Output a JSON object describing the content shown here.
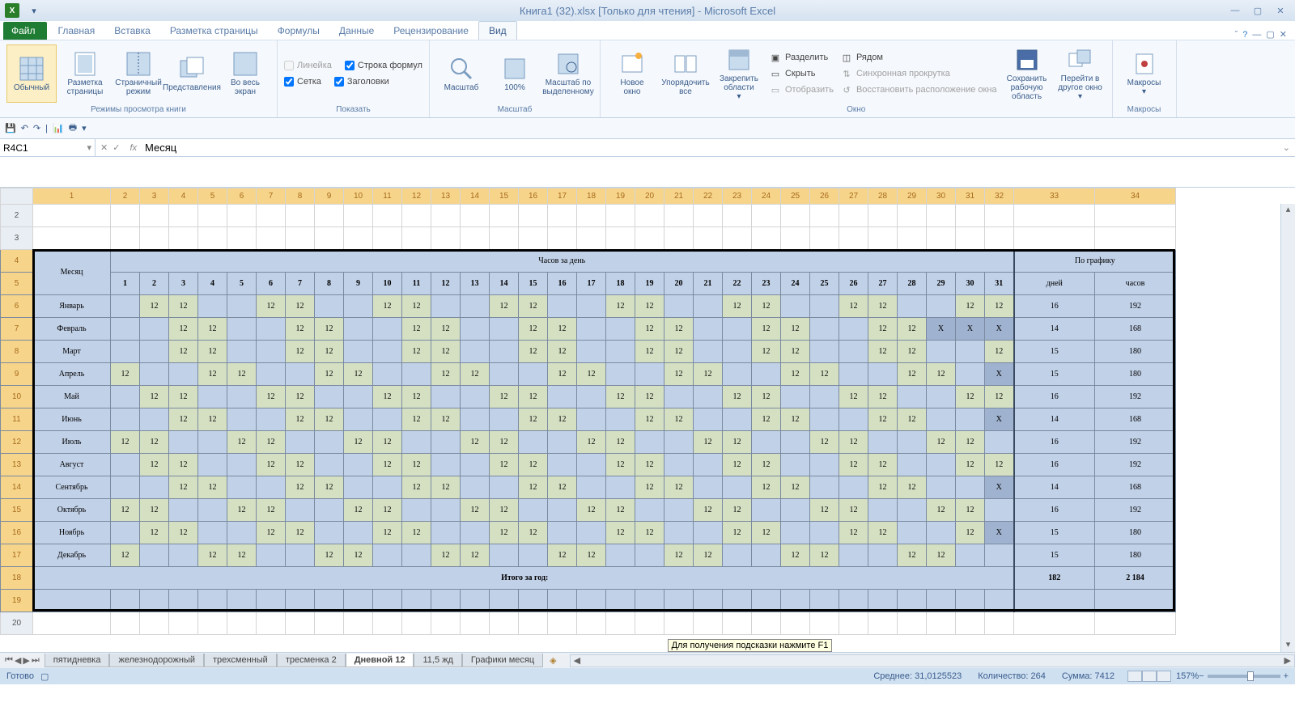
{
  "title": "Книга1 (32).xlsx  [Только для чтения]  -  Microsoft Excel",
  "tabs": {
    "file": "Файл",
    "home": "Главная",
    "insert": "Вставка",
    "layout": "Разметка страницы",
    "formulas": "Формулы",
    "data": "Данные",
    "review": "Рецензирование",
    "view": "Вид"
  },
  "ribbon": {
    "g1": {
      "label": "Режимы просмотра книги",
      "normal": "Обычный",
      "pagelayout": "Разметка\nстраницы",
      "pagebreak": "Страничный\nрежим",
      "custom": "Представления",
      "full": "Во весь\nэкран"
    },
    "g2": {
      "label": "Показать",
      "ruler": "Линейка",
      "formula": "Строка формул",
      "grid": "Сетка",
      "headings": "Заголовки"
    },
    "g3": {
      "label": "Масштаб",
      "zoom": "Масштаб",
      "z100": "100%",
      "zsel": "Масштаб по\nвыделенному"
    },
    "g4": {
      "label": "Окно",
      "newwin": "Новое\nокно",
      "arrange": "Упорядочить\nвсе",
      "freeze": "Закрепить\nобласти",
      "split": "Разделить",
      "hide": "Скрыть",
      "unhide": "Отобразить",
      "side": "Рядом",
      "sync": "Синхронная прокрутка",
      "reset": "Восстановить расположение окна",
      "save": "Сохранить\nрабочую область",
      "switch": "Перейти в\nдругое окно"
    },
    "g5": {
      "label": "Макросы",
      "macros": "Макросы"
    }
  },
  "namebox": "R4C1",
  "formula": "Месяц",
  "columns": [
    "1",
    "2",
    "3",
    "4",
    "5",
    "6",
    "7",
    "8",
    "9",
    "10",
    "11",
    "12",
    "13",
    "14",
    "15",
    "16",
    "17",
    "18",
    "19",
    "20",
    "21",
    "22",
    "23",
    "24",
    "25",
    "26",
    "27",
    "28",
    "29",
    "30",
    "31",
    "32",
    "33",
    "34"
  ],
  "rows_visible": [
    "2",
    "3",
    "4",
    "5",
    "6",
    "7",
    "8",
    "9",
    "10",
    "11",
    "12",
    "13",
    "14",
    "15",
    "16",
    "17",
    "18",
    "19",
    "20"
  ],
  "hdr": {
    "month": "Месяц",
    "hoursday": "Часов за день",
    "schedule": "По графику",
    "days": "дней",
    "hours": "часов"
  },
  "days": [
    "1",
    "2",
    "3",
    "4",
    "5",
    "6",
    "7",
    "8",
    "9",
    "10",
    "11",
    "12",
    "13",
    "14",
    "15",
    "16",
    "17",
    "18",
    "19",
    "20",
    "21",
    "22",
    "23",
    "24",
    "25",
    "26",
    "27",
    "28",
    "29",
    "30",
    "31"
  ],
  "months": [
    {
      "name": "Январь",
      "d": [
        "",
        "12",
        "12",
        "",
        "",
        "12",
        "12",
        "",
        "",
        "12",
        "12",
        "",
        "",
        "12",
        "12",
        "",
        "",
        "12",
        "12",
        "",
        "",
        "12",
        "12",
        "",
        "",
        "12",
        "12",
        "",
        "",
        "12",
        "12"
      ],
      "days": "16",
      "hours": "192"
    },
    {
      "name": "Февраль",
      "d": [
        "",
        "",
        "12",
        "12",
        "",
        "",
        "12",
        "12",
        "",
        "",
        "12",
        "12",
        "",
        "",
        "12",
        "12",
        "",
        "",
        "12",
        "12",
        "",
        "",
        "12",
        "12",
        "",
        "",
        "12",
        "12",
        "X",
        "X",
        "X"
      ],
      "days": "14",
      "hours": "168"
    },
    {
      "name": "Март",
      "d": [
        "",
        "",
        "12",
        "12",
        "",
        "",
        "12",
        "12",
        "",
        "",
        "12",
        "12",
        "",
        "",
        "12",
        "12",
        "",
        "",
        "12",
        "12",
        "",
        "",
        "12",
        "12",
        "",
        "",
        "12",
        "12",
        "",
        "",
        "12"
      ],
      "days": "15",
      "hours": "180"
    },
    {
      "name": "Апрель",
      "d": [
        "12",
        "",
        "",
        "12",
        "12",
        "",
        "",
        "12",
        "12",
        "",
        "",
        "12",
        "12",
        "",
        "",
        "12",
        "12",
        "",
        "",
        "12",
        "12",
        "",
        "",
        "12",
        "12",
        "",
        "",
        "12",
        "12",
        "",
        "X"
      ],
      "days": "15",
      "hours": "180"
    },
    {
      "name": "Май",
      "d": [
        "",
        "12",
        "12",
        "",
        "",
        "12",
        "12",
        "",
        "",
        "12",
        "12",
        "",
        "",
        "12",
        "12",
        "",
        "",
        "12",
        "12",
        "",
        "",
        "12",
        "12",
        "",
        "",
        "12",
        "12",
        "",
        "",
        "12",
        "12"
      ],
      "days": "16",
      "hours": "192"
    },
    {
      "name": "Июнь",
      "d": [
        "",
        "",
        "12",
        "12",
        "",
        "",
        "12",
        "12",
        "",
        "",
        "12",
        "12",
        "",
        "",
        "12",
        "12",
        "",
        "",
        "12",
        "12",
        "",
        "",
        "12",
        "12",
        "",
        "",
        "12",
        "12",
        "",
        "",
        "X"
      ],
      "days": "14",
      "hours": "168"
    },
    {
      "name": "Июль",
      "d": [
        "12",
        "12",
        "",
        "",
        "12",
        "12",
        "",
        "",
        "12",
        "12",
        "",
        "",
        "12",
        "12",
        "",
        "",
        "12",
        "12",
        "",
        "",
        "12",
        "12",
        "",
        "",
        "12",
        "12",
        "",
        "",
        "12",
        "12",
        ""
      ],
      "days": "16",
      "hours": "192"
    },
    {
      "name": "Август",
      "d": [
        "",
        "12",
        "12",
        "",
        "",
        "12",
        "12",
        "",
        "",
        "12",
        "12",
        "",
        "",
        "12",
        "12",
        "",
        "",
        "12",
        "12",
        "",
        "",
        "12",
        "12",
        "",
        "",
        "12",
        "12",
        "",
        "",
        "12",
        "12"
      ],
      "days": "16",
      "hours": "192"
    },
    {
      "name": "Сентябрь",
      "d": [
        "",
        "",
        "12",
        "12",
        "",
        "",
        "12",
        "12",
        "",
        "",
        "12",
        "12",
        "",
        "",
        "12",
        "12",
        "",
        "",
        "12",
        "12",
        "",
        "",
        "12",
        "12",
        "",
        "",
        "12",
        "12",
        "",
        "",
        "X"
      ],
      "days": "14",
      "hours": "168"
    },
    {
      "name": "Октябрь",
      "d": [
        "12",
        "12",
        "",
        "",
        "12",
        "12",
        "",
        "",
        "12",
        "12",
        "",
        "",
        "12",
        "12",
        "",
        "",
        "12",
        "12",
        "",
        "",
        "12",
        "12",
        "",
        "",
        "12",
        "12",
        "",
        "",
        "12",
        "12",
        ""
      ],
      "days": "16",
      "hours": "192"
    },
    {
      "name": "Ноябрь",
      "d": [
        "",
        "12",
        "12",
        "",
        "",
        "12",
        "12",
        "",
        "",
        "12",
        "12",
        "",
        "",
        "12",
        "12",
        "",
        "",
        "12",
        "12",
        "",
        "",
        "12",
        "12",
        "",
        "",
        "12",
        "12",
        "",
        "",
        "12",
        "X"
      ],
      "days": "15",
      "hours": "180"
    },
    {
      "name": "Декабрь",
      "d": [
        "12",
        "",
        "",
        "12",
        "12",
        "",
        "",
        "12",
        "12",
        "",
        "",
        "12",
        "12",
        "",
        "",
        "12",
        "12",
        "",
        "",
        "12",
        "12",
        "",
        "",
        "12",
        "12",
        "",
        "",
        "12",
        "12",
        "",
        ""
      ],
      "days": "15",
      "hours": "180"
    }
  ],
  "total": {
    "label": "Итого за год:",
    "days": "182",
    "hours": "2 184"
  },
  "sheets": [
    "пятидневка",
    "железнодорожный",
    "трехсменный",
    "тресменка 2",
    "Дневной 12",
    "11,5 жд",
    "Графики месяц"
  ],
  "active_sheet": 4,
  "tooltip": "Для получения подсказки нажмите F1",
  "status": {
    "ready": "Готово",
    "avg_l": "Среднее:",
    "avg": "31,0125523",
    "cnt_l": "Количество:",
    "cnt": "264",
    "sum_l": "Сумма:",
    "sum": "7412",
    "zoom": "157%"
  }
}
